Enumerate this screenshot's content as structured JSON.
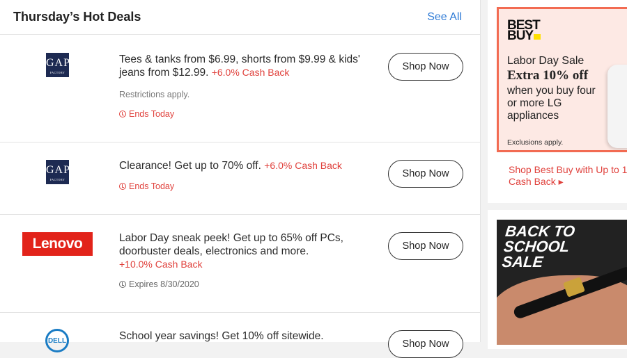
{
  "header": {
    "title": "Thursday’s Hot Deals",
    "see_all": "See All"
  },
  "deals": [
    {
      "logo_text": "GAP",
      "logo_sub": "FACTORY",
      "description": "Tees & tanks from $6.99, shorts from $9.99 & kids' jeans from $12.99.",
      "cashback": "+6.0% Cash Back",
      "note": "Restrictions apply.",
      "status": "Ends Today",
      "button": "Shop Now"
    },
    {
      "logo_text": "GAP",
      "logo_sub": "FACTORY",
      "description": "Clearance! Get up to 70% off.",
      "cashback": "+6.0% Cash Back",
      "status": "Ends Today",
      "button": "Shop Now"
    },
    {
      "logo_text": "Lenovo",
      "description": "Labor Day sneak peek! Get up to 65% off PCs, doorbuster deals, electronics and more.",
      "cashback": "+10.0% Cash Back",
      "status": "Expires 8/30/2020",
      "button": "Shop Now"
    },
    {
      "logo_text": "DELL",
      "description": "School year savings! Get 10% off sitewide.",
      "button": "Shop Now"
    }
  ],
  "sidebar": {
    "ad1": {
      "brand_line1": "BEST",
      "brand_line2": "BUY",
      "line1": "Labor Day Sale",
      "line2": "Extra 10% off",
      "line3": "when you buy four or more LG appliances",
      "exclusions": "Exclusions apply.",
      "link": "Shop Best Buy with Up to 1",
      "link2": "Cash Back ▸"
    },
    "ad2": {
      "title_line1": "BACK TO SCHOOL",
      "title_line2": "SALE"
    }
  },
  "colors": {
    "accent_link": "#2f7bd6",
    "cashback_red": "#e0413c",
    "gap_navy": "#1d2a52",
    "lenovo_red": "#e2231a"
  }
}
